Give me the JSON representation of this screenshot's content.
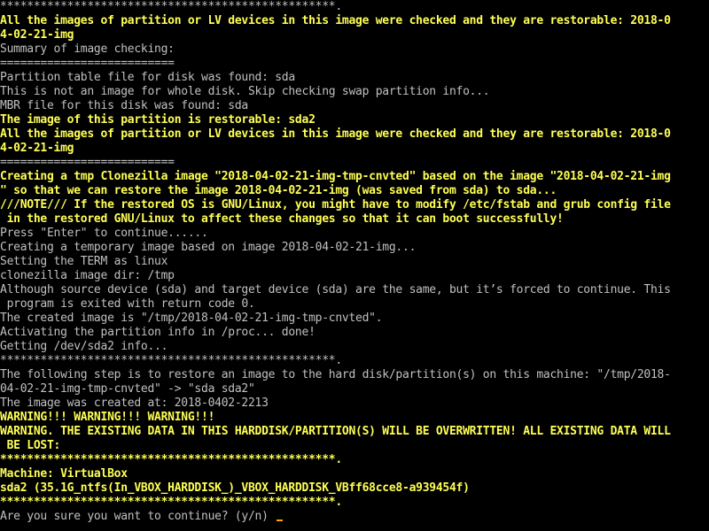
{
  "terminal": {
    "lines": [
      {
        "text": "**************************************************.",
        "color": "white"
      },
      {
        "text": "All the images of partition or LV devices in this image were checked and they are restorable: 2018-0",
        "color": "yellow"
      },
      {
        "text": "4-02-21-img",
        "color": "yellow"
      },
      {
        "text": "Summary of image checking:",
        "color": "white"
      },
      {
        "text": "==========================",
        "color": "white"
      },
      {
        "text": "Partition table file for disk was found: sda",
        "color": "white"
      },
      {
        "text": "This is not an image for whole disk. Skip checking swap partition info...",
        "color": "white"
      },
      {
        "text": "MBR file for this disk was found: sda",
        "color": "white"
      },
      {
        "text": "The image of this partition is restorable: sda2",
        "color": "yellow"
      },
      {
        "text": "All the images of partition or LV devices in this image were checked and they are restorable: 2018-0",
        "color": "yellow"
      },
      {
        "text": "4-02-21-img",
        "color": "yellow"
      },
      {
        "text": "==========================",
        "color": "white"
      },
      {
        "text": "Creating a tmp Clonezilla image \"2018-04-02-21-img-tmp-cnvted\" based on the image \"2018-04-02-21-img",
        "color": "yellow"
      },
      {
        "text": "\" so that we can restore the image 2018-04-02-21-img (was saved from sda) to sda...",
        "color": "yellow"
      },
      {
        "text": "///NOTE/// If the restored OS is GNU/Linux, you might have to modify /etc/fstab and grub config file",
        "color": "yellow"
      },
      {
        "text": " in the restored GNU/Linux to affect these changes so that it can boot successfully!",
        "color": "yellow"
      },
      {
        "text": "Press \"Enter\" to continue......",
        "color": "white"
      },
      {
        "text": "Creating a temporary image based on image 2018-04-02-21-img...",
        "color": "white"
      },
      {
        "text": "Setting the TERM as linux",
        "color": "white"
      },
      {
        "text": "clonezilla image dir: /tmp",
        "color": "white"
      },
      {
        "text": "Although source device (sda) and target device (sda) are the same, but it’s forced to continue. This",
        "color": "white"
      },
      {
        "text": " program is exited with return code 0.",
        "color": "white"
      },
      {
        "text": "The created image is \"/tmp/2018-04-02-21-img-tmp-cnvted\".",
        "color": "white"
      },
      {
        "text": "Activating the partition info in /proc... done!",
        "color": "white"
      },
      {
        "text": "Getting /dev/sda2 info...",
        "color": "white"
      },
      {
        "text": "**************************************************.",
        "color": "white"
      },
      {
        "text": "The following step is to restore an image to the hard disk/partition(s) on this machine: \"/tmp/2018-",
        "color": "white"
      },
      {
        "text": "04-02-21-img-tmp-cnvted\" -> \"sda sda2\"",
        "color": "white"
      },
      {
        "text": "The image was created at: 2018-0402-2213",
        "color": "white"
      },
      {
        "text": "WARNING!!! WARNING!!! WARNING!!!",
        "color": "yellow"
      },
      {
        "text": "WARNING. THE EXISTING DATA IN THIS HARDDISK/PARTITION(S) WILL BE OVERWRITTEN! ALL EXISTING DATA WILL",
        "color": "yellow"
      },
      {
        "text": " BE LOST:",
        "color": "yellow"
      },
      {
        "text": "**************************************************.",
        "color": "yellow"
      },
      {
        "text": "Machine: VirtualBox",
        "color": "yellow"
      },
      {
        "text": "sda2 (35.1G_ntfs(In_VBOX_HARDDISK_)_VBOX_HARDDISK_VBff68cce8-a939454f)",
        "color": "yellow"
      },
      {
        "text": "**************************************************.",
        "color": "yellow"
      }
    ],
    "prompt": "Are you sure you want to continue? (y/n) ",
    "colors": {
      "background": "#000000",
      "white": "#c0c0c0",
      "yellow": "#ffff55",
      "cursor": "#ffa500"
    }
  }
}
